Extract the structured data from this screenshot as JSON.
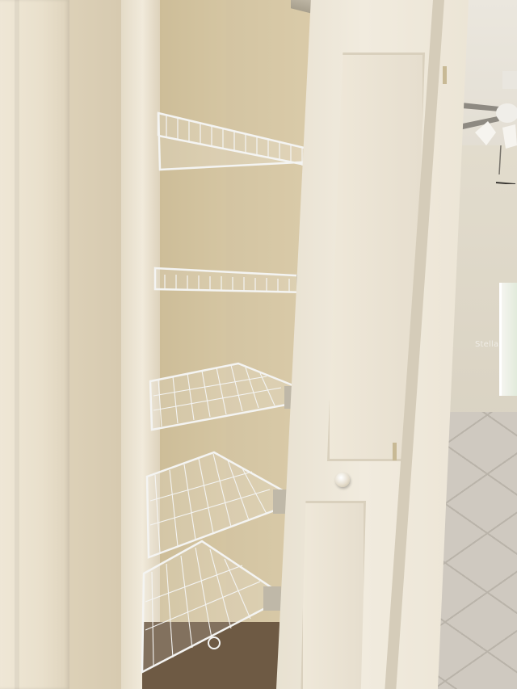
{
  "scene": {
    "subject": "pantry-closet-with-wire-shelves",
    "shelf_count": 5,
    "watermark_text": "Stella"
  },
  "colors": {
    "closet_wall": "#d3c4a2",
    "door": "#ede6d6",
    "shelf_wire": "#f4f4f2",
    "floor_tile": "#cfc9c0",
    "closet_floor": "#6e5a44"
  },
  "icons": {
    "ceiling_fan": "ceiling-fan-icon",
    "door_knob": "door-knob-icon",
    "hinge": "hinge-icon"
  }
}
